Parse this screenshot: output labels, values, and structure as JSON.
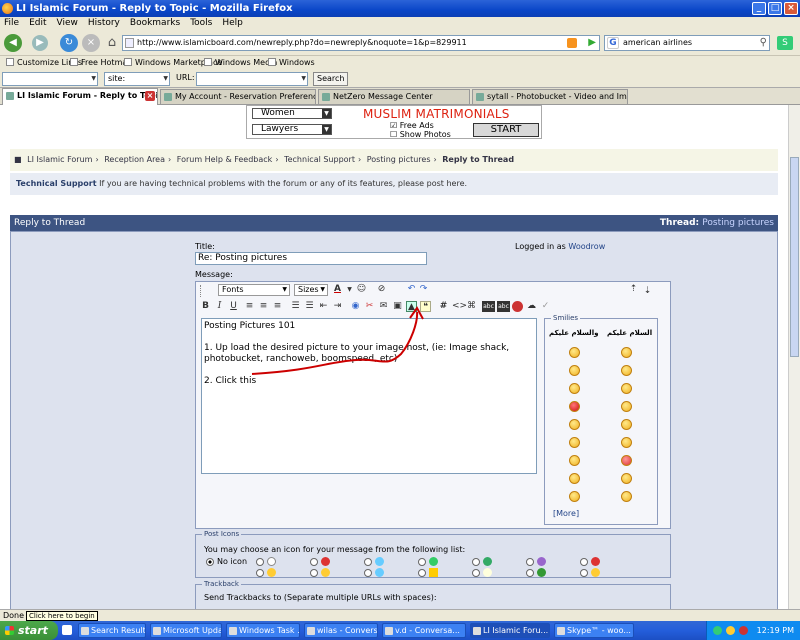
{
  "window": {
    "title": "LI Islamic Forum - Reply to Topic - Mozilla Firefox"
  },
  "menu": [
    "File",
    "Edit",
    "View",
    "History",
    "Bookmarks",
    "Tools",
    "Help"
  ],
  "navbar": {
    "url": "http://www.islamicboard.com/newreply.php?do=newreply&noquote=1&p=829911",
    "search_value": "american airlines"
  },
  "bookmarks": [
    "Customize Links",
    "Free Hotmail",
    "Windows Marketplace",
    "Windows Media",
    "Windows"
  ],
  "search_toolbar": {
    "site_label": "site:",
    "url_label": "URL:",
    "search_button": "Search"
  },
  "tabs": [
    {
      "label": "LI Islamic Forum - Reply to Topic",
      "active": true
    },
    {
      "label": "My Account - Reservation Preferences"
    },
    {
      "label": "NetZero Message Center"
    },
    {
      "label": "sytall - Photobucket - Video and Imag..."
    }
  ],
  "banner": {
    "select1": "Women",
    "select2": "Lawyers",
    "headline": "MUSLIM MATRIMONIALS",
    "check1": "Free Ads",
    "check2": "Show Photos",
    "button": "START"
  },
  "breadcrumb": [
    "LI Islamic Forum",
    "Reception Area",
    "Forum Help & Feedback",
    "Technical Support",
    "Posting pictures",
    "Reply to Thread"
  ],
  "forum_info": {
    "name": "Technical Support",
    "desc": "If you are having technical problems with the forum or any of its features, please post here."
  },
  "thread_header": {
    "title": "Reply to Thread",
    "thread_label": "Thread:",
    "thread_name": "Posting pictures"
  },
  "form": {
    "title_label": "Title:",
    "title_value": "Re: Posting pictures",
    "logged_in_label": "Logged in as",
    "username": "Woodrow",
    "message_label": "Message:"
  },
  "editor": {
    "font_dropdown": "Fonts",
    "size_dropdown": "Sizes",
    "message_lines": [
      "Posting Pictures 101",
      "1. Up load the desired picture to your image host, (ie: Image shack, photobucket, ranchoweb, boomspeed, etc)",
      "2. Click this"
    ]
  },
  "smilies": {
    "title": "Smilies",
    "col1_header": "والسلام عليكم",
    "col2_header": "السلام عليكم",
    "more_link": "[More]"
  },
  "post_icons": {
    "legend": "Post Icons",
    "desc": "You may choose an icon for your message from the following list:",
    "no_icon": "No icon"
  },
  "trackback": {
    "legend": "Trackback",
    "desc": "Send Trackbacks to (Separate multiple URLs with spaces):"
  },
  "status": {
    "text": "Done",
    "tooltip": "Click here to begin"
  },
  "taskbar": {
    "start": "start",
    "items": [
      "Search Results",
      "Microsoft Upda...",
      "Windows Task ...",
      "wilas - Convers...",
      "v.d - Conversa...",
      "LI Islamic Foru...",
      "Skype™ - woo..."
    ],
    "clock": "12:19 PM"
  },
  "colors": {
    "forum_header": "#3d5482",
    "panel_bg": "#dde2ee",
    "annotation_arrow": "#cc0000"
  }
}
